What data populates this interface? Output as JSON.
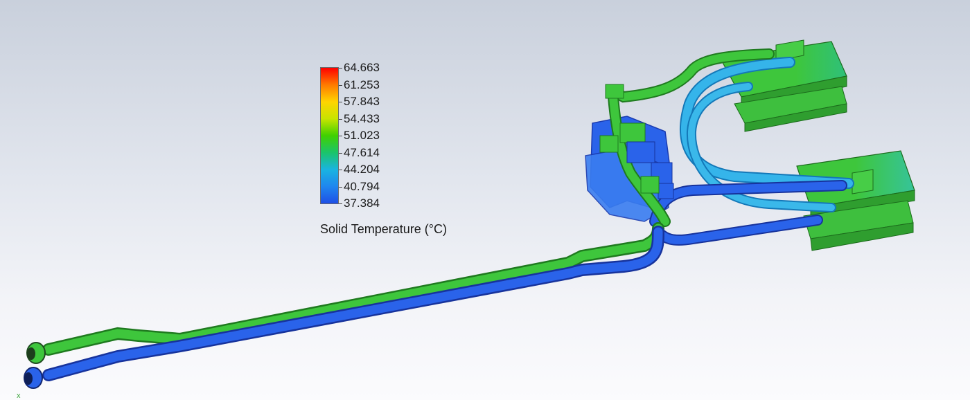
{
  "legend": {
    "title": "Solid Temperature (°C)",
    "ticks": [
      "64.663",
      "61.253",
      "57.843",
      "54.433",
      "51.023",
      "47.614",
      "44.204",
      "40.794",
      "37.384"
    ],
    "colors": {
      "stops": [
        "#ff0000",
        "#ff7a00",
        "#ffd400",
        "#c8e400",
        "#40d000",
        "#1bc46a",
        "#19b4e0",
        "#1f86ee",
        "#1f4fe6"
      ]
    }
  },
  "model": {
    "colors": {
      "warm_pipe": "#3ec63c",
      "cool_pipe": "#2a63ea",
      "mid_pipe": "#2fb1e6",
      "plate": "#42c842"
    }
  },
  "triad": {
    "axis_label": "x"
  }
}
